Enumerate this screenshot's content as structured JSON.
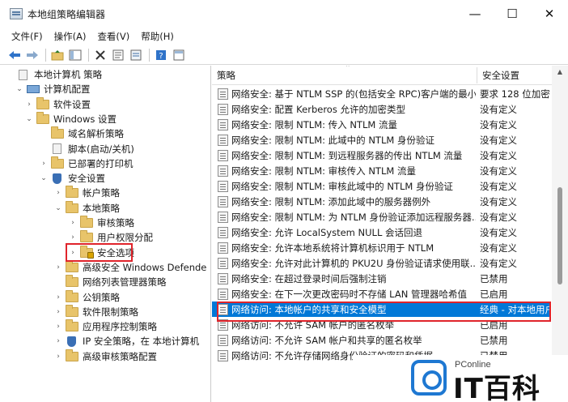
{
  "window": {
    "title": "本地组策略编辑器"
  },
  "window_buttons": {
    "minimize": "—",
    "maximize": "☐",
    "close": "✕"
  },
  "menu": [
    {
      "label": "文件(F)"
    },
    {
      "label": "操作(A)"
    },
    {
      "label": "查看(V)"
    },
    {
      "label": "帮助(H)"
    }
  ],
  "tree": [
    {
      "label": "本地计算机 策略",
      "level": 0,
      "expander": "",
      "icon": "doc-icon"
    },
    {
      "label": "计算机配置",
      "level": 1,
      "expander": "⌄",
      "icon": "computer-icon"
    },
    {
      "label": "软件设置",
      "level": 2,
      "expander": "›",
      "icon": "folder-icon"
    },
    {
      "label": "Windows 设置",
      "level": 2,
      "expander": "⌄",
      "icon": "folder-icon"
    },
    {
      "label": "域名解析策略",
      "level": 3,
      "expander": "",
      "icon": "folder-icon"
    },
    {
      "label": "脚本(启动/关机)",
      "level": 3,
      "expander": "",
      "icon": "doc-icon"
    },
    {
      "label": "已部署的打印机",
      "level": 3,
      "expander": "›",
      "icon": "folder-icon"
    },
    {
      "label": "安全设置",
      "level": 3,
      "expander": "⌄",
      "icon": "shield-icon"
    },
    {
      "label": "帐户策略",
      "level": 4,
      "expander": "›",
      "icon": "folder-icon"
    },
    {
      "label": "本地策略",
      "level": 4,
      "expander": "⌄",
      "icon": "folder-icon"
    },
    {
      "label": "审核策略",
      "level": 5,
      "expander": "›",
      "icon": "folder-icon"
    },
    {
      "label": "用户权限分配",
      "level": 5,
      "expander": "›",
      "icon": "folder-icon"
    },
    {
      "label": "安全选项",
      "level": 5,
      "expander": "›",
      "icon": "lock-folder-icon"
    },
    {
      "label": "高级安全 Windows Defende",
      "level": 4,
      "expander": "›",
      "icon": "folder-icon"
    },
    {
      "label": "网络列表管理器策略",
      "level": 4,
      "expander": "",
      "icon": "folder-icon"
    },
    {
      "label": "公钥策略",
      "level": 4,
      "expander": "›",
      "icon": "folder-icon"
    },
    {
      "label": "软件限制策略",
      "level": 4,
      "expander": "›",
      "icon": "folder-icon"
    },
    {
      "label": "应用程序控制策略",
      "level": 4,
      "expander": "›",
      "icon": "folder-icon"
    },
    {
      "label": "IP 安全策略，在 本地计算机",
      "level": 4,
      "expander": "›",
      "icon": "shield-icon"
    },
    {
      "label": "高级审核策略配置",
      "level": 4,
      "expander": "›",
      "icon": "folder-icon"
    }
  ],
  "columns": {
    "policy": "策略",
    "setting": "安全设置"
  },
  "policies": [
    {
      "name": "网络安全: 基于 NTLM SSP 的(包括安全 RPC)客户端的最小...",
      "value": "要求 128 位加密"
    },
    {
      "name": "网络安全: 配置 Kerberos 允许的加密类型",
      "value": "没有定义"
    },
    {
      "name": "网络安全: 限制 NTLM: 传入 NTLM 流量",
      "value": "没有定义"
    },
    {
      "name": "网络安全: 限制 NTLM: 此域中的 NTLM 身份验证",
      "value": "没有定义"
    },
    {
      "name": "网络安全: 限制 NTLM: 到远程服务器的传出 NTLM 流量",
      "value": "没有定义"
    },
    {
      "name": "网络安全: 限制 NTLM: 审核传入 NTLM 流量",
      "value": "没有定义"
    },
    {
      "name": "网络安全: 限制 NTLM: 审核此域中的 NTLM 身份验证",
      "value": "没有定义"
    },
    {
      "name": "网络安全: 限制 NTLM: 添加此域中的服务器例外",
      "value": "没有定义"
    },
    {
      "name": "网络安全: 限制 NTLM: 为 NTLM 身份验证添加远程服务器...",
      "value": "没有定义"
    },
    {
      "name": "网络安全: 允许 LocalSystem NULL 会话回退",
      "value": "没有定义"
    },
    {
      "name": "网络安全: 允许本地系统将计算机标识用于 NTLM",
      "value": "没有定义"
    },
    {
      "name": "网络安全: 允许对此计算机的 PKU2U 身份验证请求使用联...",
      "value": "没有定义"
    },
    {
      "name": "网络安全: 在超过登录时间后强制注销",
      "value": "已禁用"
    },
    {
      "name": "网络安全: 在下一次更改密码时不存储 LAN 管理器哈希值",
      "value": "已启用"
    },
    {
      "name": "网络访问: 本地帐户的共享和安全模型",
      "value": "经典 - 对本地用户"
    },
    {
      "name": "网络访问: 不允许 SAM 帐户的匿名枚举",
      "value": "已启用"
    },
    {
      "name": "网络访问: 不允许 SAM 帐户和共享的匿名枚举",
      "value": "已禁用"
    },
    {
      "name": "网络访问: 不允许存储网络身份验证的密码和凭据",
      "value": "已禁用"
    }
  ],
  "selected_policy_index": 14,
  "watermark": {
    "small": "PConline",
    "big": "IT百科"
  },
  "colors": {
    "selection": "#0078d7",
    "highlight_box": "#e0242b",
    "folder": "#e8c46a"
  }
}
